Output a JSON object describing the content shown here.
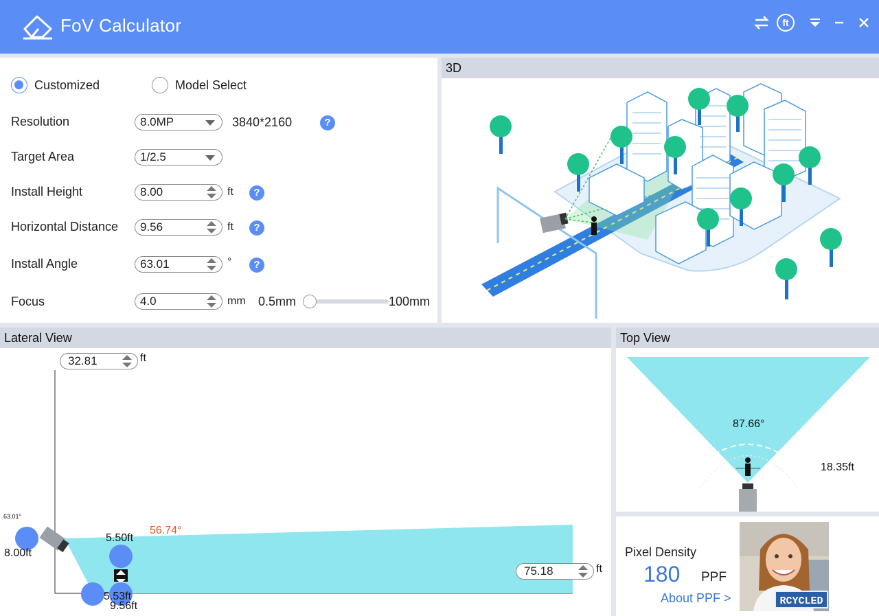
{
  "app": {
    "title": "FoV Calculator",
    "accent": "#5b8df7",
    "window_controls": [
      "swap-icon",
      "feet-unit-icon",
      "dropdown-icon",
      "minimize-icon",
      "close-icon"
    ],
    "unit_button_label": "ft"
  },
  "settings": {
    "mode_customized": "Customized",
    "mode_model_select": "Model Select",
    "selected_mode": "Customized",
    "resolution": {
      "label": "Resolution",
      "value": "8.0MP",
      "pixels": "3840*2160"
    },
    "target_area": {
      "label": "Target Area",
      "value": "1/2.5"
    },
    "install_height": {
      "label": "Install Height",
      "value": "8.00",
      "unit": "ft"
    },
    "horizontal_distance": {
      "label": "Horizontal Distance",
      "value": "9.56",
      "unit": "ft"
    },
    "install_angle": {
      "label": "Install Angle",
      "value": "63.01",
      "unit": "°"
    },
    "focus": {
      "label": "Focus",
      "value": "4.0",
      "unit": "mm",
      "min_label": "0.5mm",
      "max_label": "100mm",
      "slider_fraction": 0.03
    },
    "help_symbol": "?"
  },
  "view3d": {
    "title": "3D"
  },
  "lateral": {
    "title": "Lateral View",
    "top_height_value": "32.81",
    "top_height_unit": "ft",
    "distance_value": "75.18",
    "distance_unit": "ft",
    "camera_angle": "63.01°",
    "camera_height": "8.00ft",
    "fov_angle": "56.74°",
    "target_height": "5.50ft",
    "near_distance": "5.53ft",
    "target_distance": "9.56ft",
    "fov_color": "#8fe6ee",
    "angle_color": "#e0561d"
  },
  "topview": {
    "title": "Top View",
    "fov_angle": "87.66°",
    "width": "18.35ft"
  },
  "density": {
    "label": "Pixel Density",
    "value": "180",
    "unit": "PPF",
    "link": "About PPF >",
    "plate_text": "RCYCLED"
  }
}
